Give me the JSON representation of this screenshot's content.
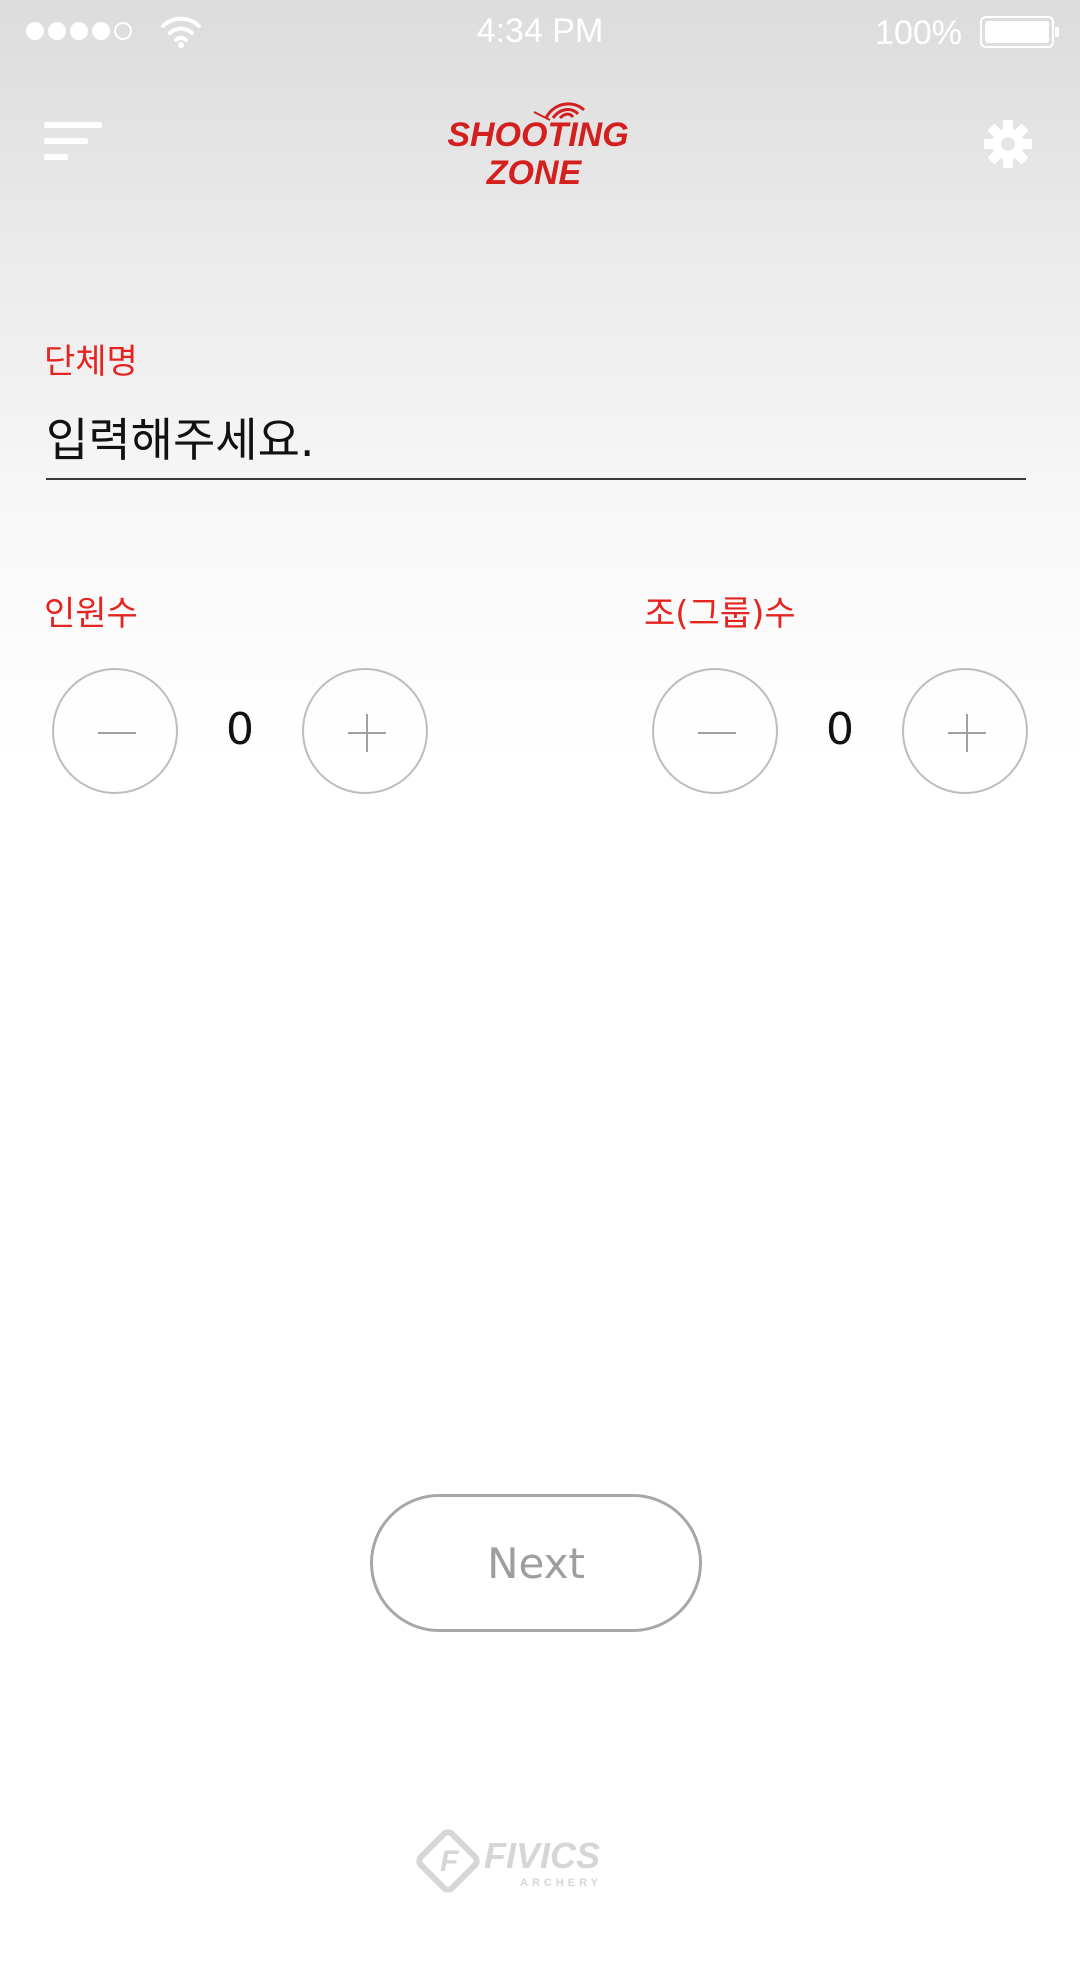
{
  "status_bar": {
    "time": "4:34 PM",
    "battery": "100%",
    "signal_icon": "signal-dots-icon",
    "wifi_icon": "wifi-icon",
    "battery_icon": "battery-icon"
  },
  "header": {
    "menu_icon": "menu-icon",
    "logo": {
      "line1": "SHOOTING",
      "line2": "ZONE"
    },
    "settings_icon": "gear-icon"
  },
  "form": {
    "group_name": {
      "label": "단체명",
      "placeholder": "입력해주세요.",
      "value": ""
    },
    "people_count": {
      "label": "인원수",
      "value": "0"
    },
    "group_count": {
      "label": "조(그룹)수",
      "value": "0"
    }
  },
  "actions": {
    "next_label": "Next"
  },
  "footer": {
    "brand": "FIVICS",
    "sub": "ARCHERY"
  },
  "colors": {
    "accent": "#e32420",
    "text": "#111111",
    "stepper_border": "#bdbdbd",
    "button_border": "#a7a7a7"
  }
}
